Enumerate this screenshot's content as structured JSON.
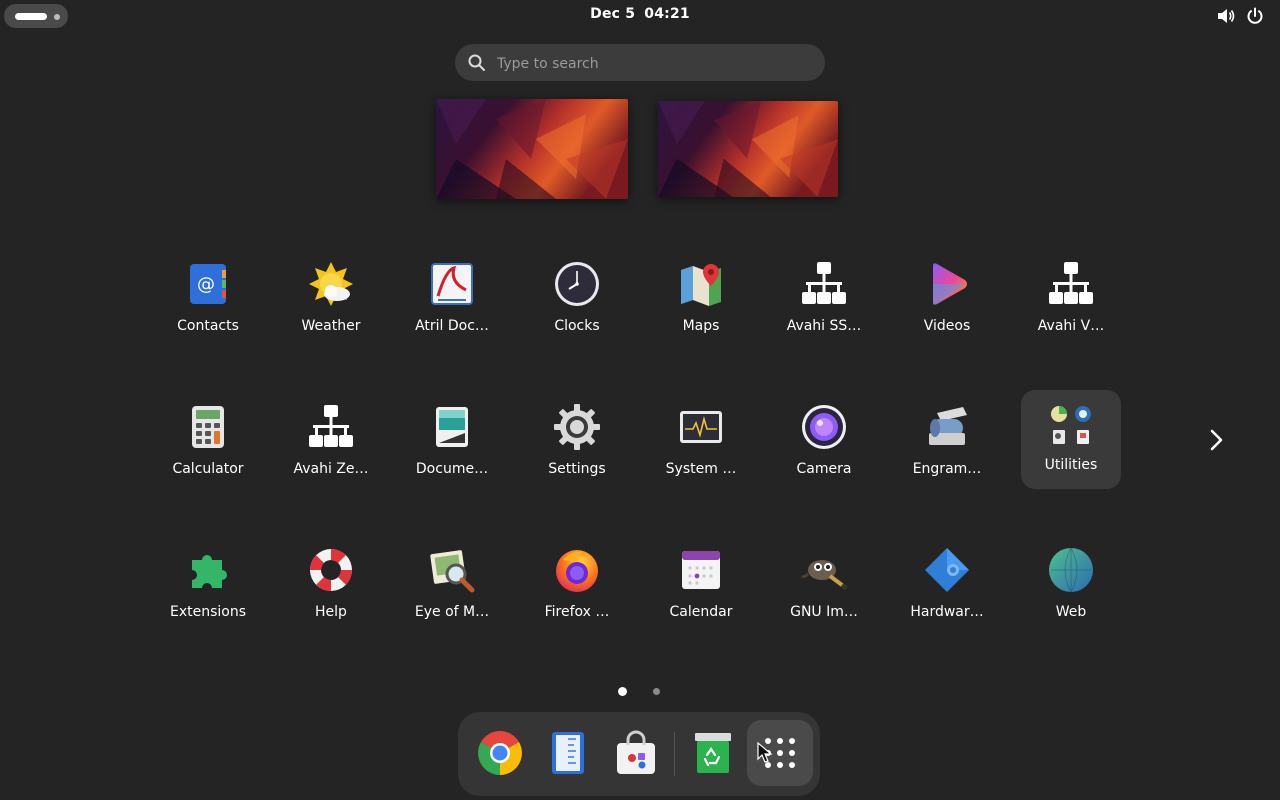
{
  "topbar": {
    "date": "Dec 5",
    "time": "04:21",
    "activities_icon": "activities-pill",
    "volume_icon": "speaker-icon",
    "power_icon": "power-icon"
  },
  "search": {
    "placeholder": "Type to search",
    "value": ""
  },
  "workspaces": [
    {
      "name": "workspace-1"
    },
    {
      "name": "workspace-2"
    }
  ],
  "apps": [
    {
      "label": "Contacts"
    },
    {
      "label": "Weather"
    },
    {
      "label": "Atril Doc…"
    },
    {
      "label": "Clocks"
    },
    {
      "label": "Maps"
    },
    {
      "label": "Avahi SS…"
    },
    {
      "label": "Videos"
    },
    {
      "label": "Avahi V…"
    },
    {
      "label": "Calculator"
    },
    {
      "label": "Avahi Ze…"
    },
    {
      "label": "Docume…"
    },
    {
      "label": "Settings"
    },
    {
      "label": "System …"
    },
    {
      "label": "Camera"
    },
    {
      "label": "Engram…"
    },
    {
      "label": "Utilities"
    },
    {
      "label": "Extensions"
    },
    {
      "label": "Help"
    },
    {
      "label": "Eye of M…"
    },
    {
      "label": "Firefox …"
    },
    {
      "label": "Calendar"
    },
    {
      "label": "GNU Im…"
    },
    {
      "label": "Hardwar…"
    },
    {
      "label": "Web"
    }
  ],
  "pager": {
    "pages": 2,
    "current": 1
  },
  "dock": [
    {
      "name": "chrome"
    },
    {
      "name": "text-editor"
    },
    {
      "name": "software"
    },
    {
      "name": "trash"
    },
    {
      "name": "show-apps"
    }
  ],
  "colors": {
    "background": "#242424",
    "search_bg": "#3c3c3c",
    "folder_bg": "#3a3a3a",
    "dock_bg": "#353535"
  }
}
